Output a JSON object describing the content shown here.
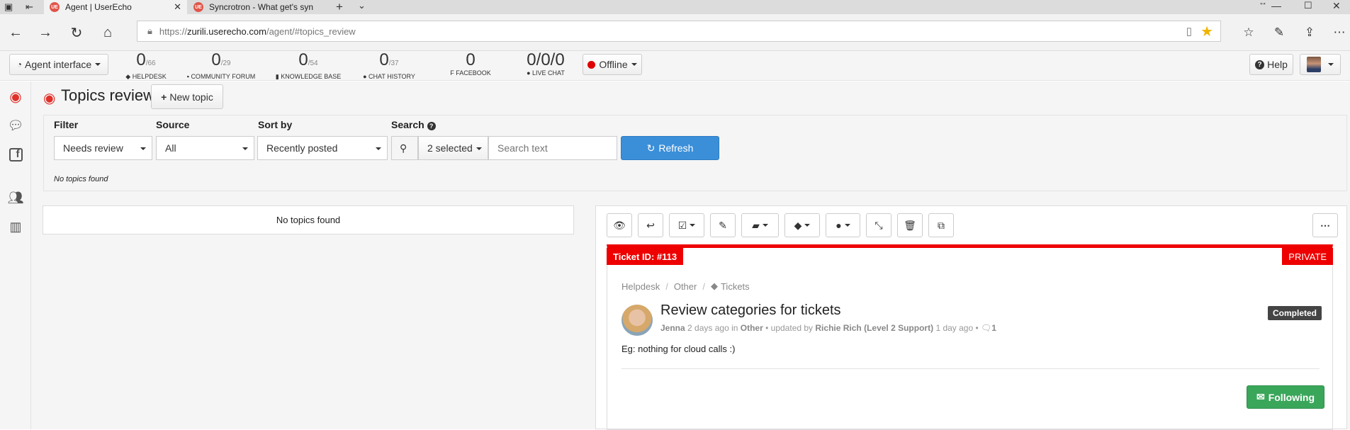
{
  "browser": {
    "tabs": [
      {
        "icon": "UE",
        "title": "Agent | UserEcho"
      },
      {
        "icon": "UE",
        "title": "Syncrotron - What get's syn"
      }
    ],
    "url_scheme": "https://",
    "url_host": "zurili.userecho.com",
    "url_path": "/agent/#topics_review"
  },
  "header": {
    "agent_interface": "Agent interface",
    "stats": [
      {
        "num": "0",
        "total": "/66",
        "label": "HELPDESK"
      },
      {
        "num": "0",
        "total": "/29",
        "label": "COMMUNITY FORUM"
      },
      {
        "num": "0",
        "total": "/54",
        "label": "KNOWLEDGE BASE"
      },
      {
        "num": "0",
        "total": "/37",
        "label": "CHAT HISTORY"
      },
      {
        "num": "0",
        "total": "",
        "label": "FACEBOOK"
      },
      {
        "num": "0/0/0",
        "total": "",
        "label": "LIVE CHAT"
      }
    ],
    "status": "Offline",
    "status_color": "#e00000",
    "help": "Help"
  },
  "page": {
    "title": "Topics review",
    "new_topic": "New topic"
  },
  "filters": {
    "filter_label": "Filter",
    "filter_value": "Needs review",
    "source_label": "Source",
    "source_value": "All",
    "sort_label": "Sort by",
    "sort_value": "Recently posted",
    "search_label": "Search",
    "selected_value": "2 selected",
    "search_placeholder": "Search text",
    "refresh": "Refresh",
    "no_topics": "No topics found"
  },
  "list": {
    "empty": "No topics found"
  },
  "ticket": {
    "id": "Ticket ID: #113",
    "privacy": "PRIVATE",
    "breadcrumb": [
      "Helpdesk",
      "Other",
      "Tickets"
    ],
    "title": "Review categories for tickets",
    "status": "Completed",
    "author": "Jenna",
    "posted": "2 days ago in",
    "category": "Other",
    "updated_by_text": "• updated by",
    "updater": "Richie Rich (Level 2 Support)",
    "updated_ago": "1 day ago •",
    "comments": "1",
    "body": "Eg: nothing for cloud calls :)",
    "follow": "Following"
  },
  "colors": {
    "accent_blue": "#3b8fd9",
    "red": "#ee0000",
    "green": "#3aa65a",
    "eye_red": "#e0302a"
  }
}
